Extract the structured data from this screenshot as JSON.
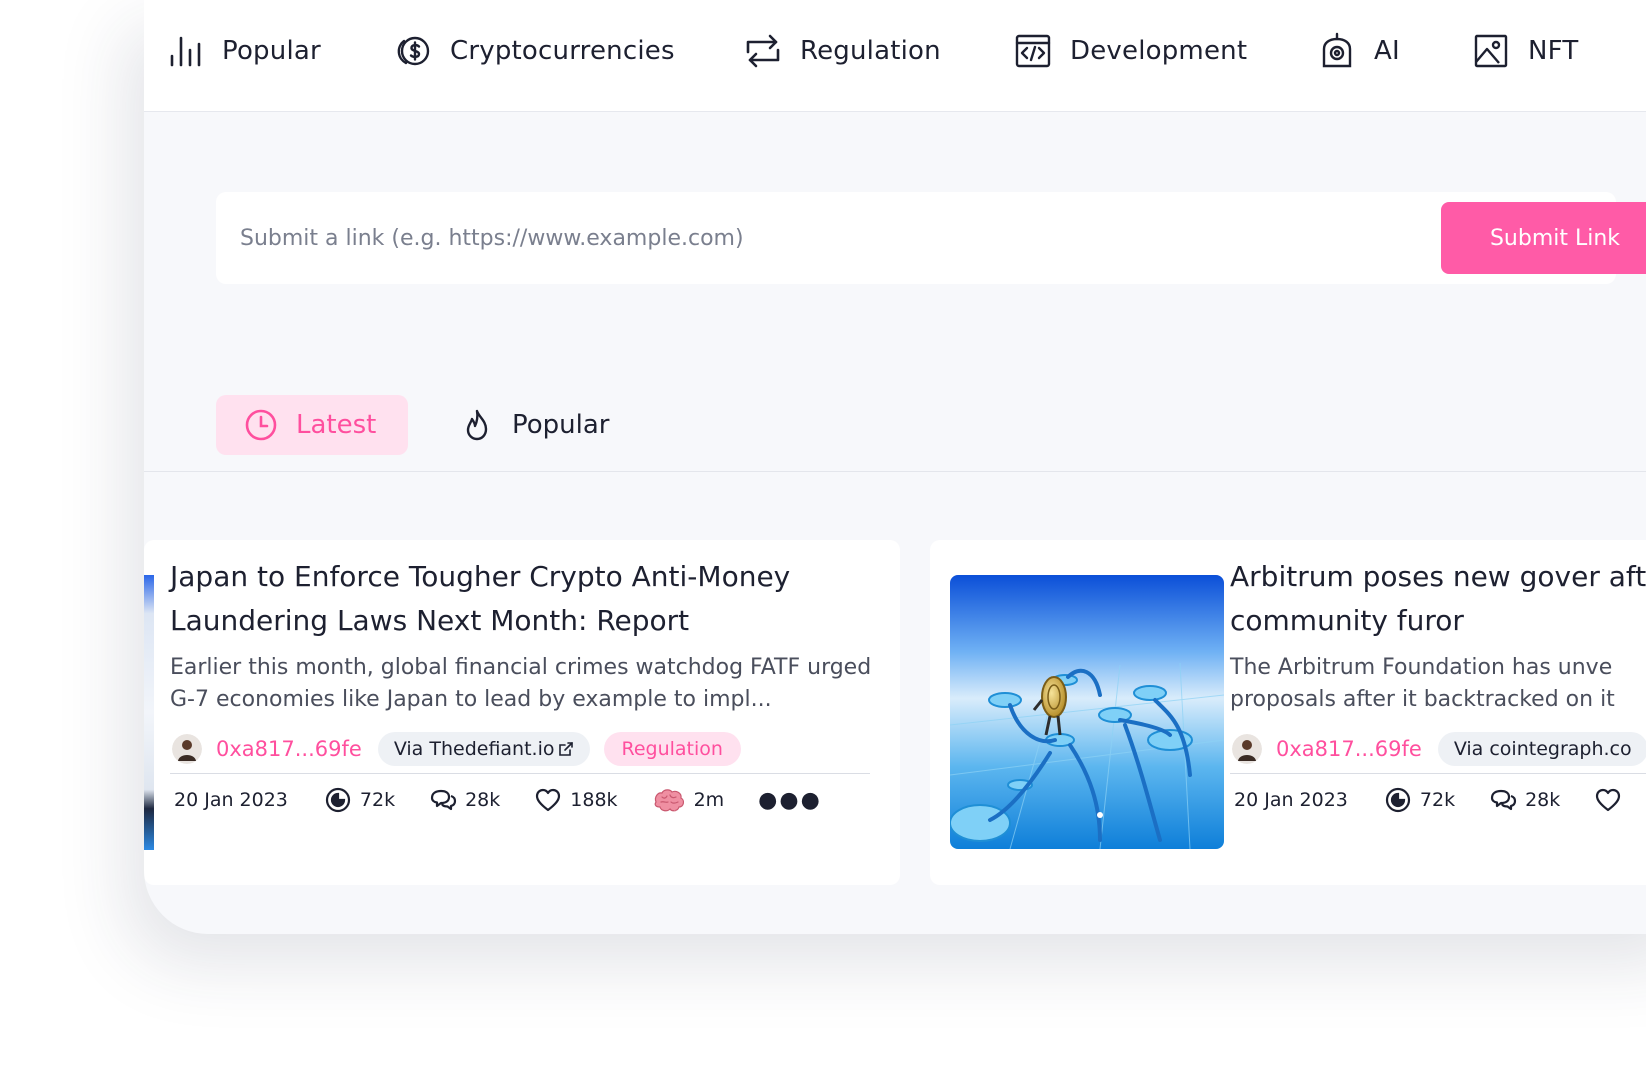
{
  "categories": [
    {
      "label": "Popular",
      "icon": "bar-chart-icon"
    },
    {
      "label": "Cryptocurrencies",
      "icon": "coins-icon"
    },
    {
      "label": "Regulation",
      "icon": "repeat-icon"
    },
    {
      "label": "Development",
      "icon": "code-icon"
    },
    {
      "label": "AI",
      "icon": "robot-icon"
    },
    {
      "label": "NFT",
      "icon": "image-icon"
    }
  ],
  "submit": {
    "placeholder": "Submit a link (e.g. https://www.example.com)",
    "button_label": "Submit Link"
  },
  "feed_tabs": [
    {
      "label": "Latest",
      "icon": "clock-icon",
      "active": true
    },
    {
      "label": "Popular",
      "icon": "flame-icon",
      "active": false
    }
  ],
  "posts": [
    {
      "title": "Japan to Enforce Tougher Crypto Anti-Money Laundering Laws Next Month: Report",
      "description": "Earlier this month, global financial crimes watchdog FATF urged G-7 economies like Japan to lead by example to impl...",
      "author": "0xa817...69fe",
      "source": "Via Thedefiant.io",
      "tag": "Regulation",
      "date": "20 Jan 2023",
      "views": "72k",
      "comments": "28k",
      "likes": "188k",
      "read_time": "2m"
    },
    {
      "title": "Arbitrum poses new gover after community furor",
      "description": "The Arbitrum Foundation has unve proposals after it backtracked on it",
      "author": "0xa817...69fe",
      "source": "Via cointegraph.co",
      "date": "20 Jan 2023",
      "views": "72k",
      "comments": "28k"
    }
  ],
  "colors": {
    "accent": "#ff5ba7",
    "accent_text": "#ff4f9e",
    "accent_soft": "#ffe1ef",
    "text": "#1d2030",
    "muted": "#4a4e5c",
    "chip": "#eef1f5",
    "panel": "#f7f8fb"
  }
}
